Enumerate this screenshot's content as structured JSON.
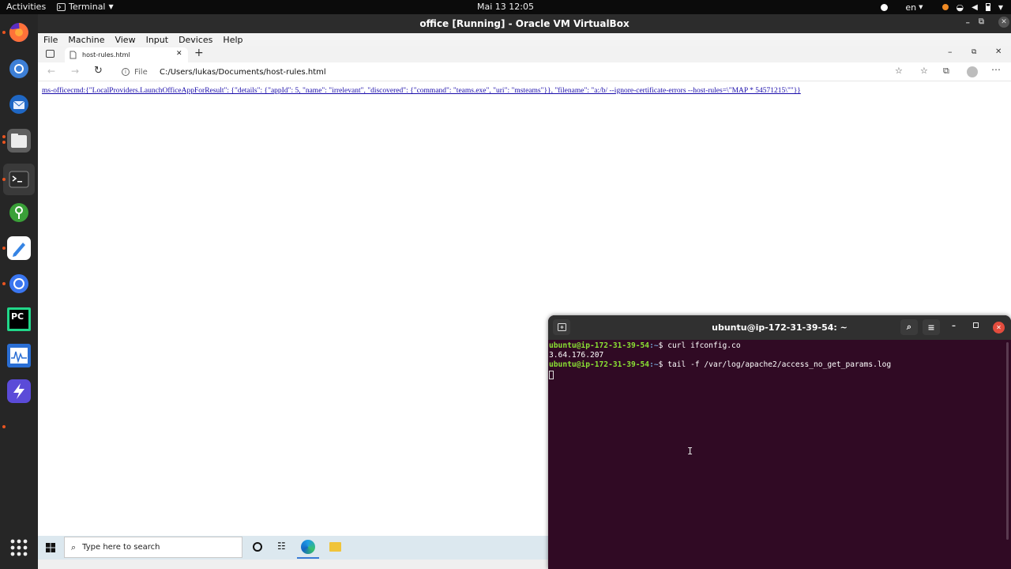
{
  "topbar": {
    "activities": "Activities",
    "app_menu": "Terminal",
    "clock": "Mai 13  12:05",
    "language": "en"
  },
  "vbox": {
    "title": "office [Running] - Oracle VM VirtualBox",
    "menu": [
      "File",
      "Machine",
      "View",
      "Input",
      "Devices",
      "Help"
    ]
  },
  "edge": {
    "tab_title": "host-rules.html",
    "url_scheme": "File",
    "url": "C:/Users/lukas/Documents/host-rules.html",
    "link_text": "ms-officecmd:{\"LocalProviders.LaunchOfficeAppForResult\": {\"details\": {\"appId\": 5, \"name\": \"irrelevant\", \"discovered\": {\"command\": \"teams.exe\", \"uri\": \"msteams\"}}, \"filename\": \"a:/b/ --ignore-certificate-errors --host-rules=\\\"MAP * 54571215\\\"\"}}"
  },
  "taskbar": {
    "search_placeholder": "Type here to search"
  },
  "terminal": {
    "title": "ubuntu@ip-172-31-39-54: ~",
    "prompt_user": "ubuntu@ip-172-31-39-54",
    "prompt_path": ":~",
    "line1_cmd": "$ curl ifconfig.co",
    "line2_out": "3.64.176.207",
    "line3_cmd": "$ tail -f /var/log/apache2/access_no_get_params.log"
  },
  "colors": {
    "terminal_bg": "#300a24",
    "prompt_green": "#8ae234",
    "prompt_blue": "#729fcf",
    "ubuntu_orange": "#e95420",
    "link_blue": "#1a0dab"
  }
}
